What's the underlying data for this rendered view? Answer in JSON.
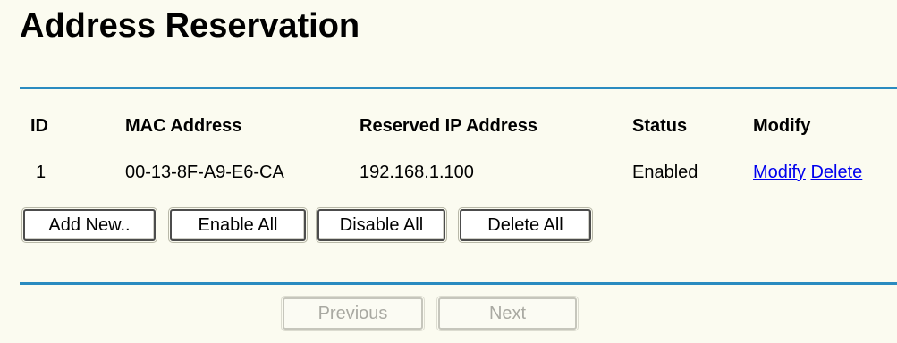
{
  "page": {
    "title": "Address Reservation"
  },
  "table": {
    "headers": {
      "id": "ID",
      "mac": "MAC Address",
      "ip": "Reserved IP Address",
      "status": "Status",
      "modify": "Modify"
    },
    "rows": [
      {
        "id": "1",
        "mac": "00-13-8F-A9-E6-CA",
        "ip": "192.168.1.100",
        "status": "Enabled",
        "modify_link": "Modify",
        "delete_link": "Delete"
      }
    ]
  },
  "actions": {
    "add_new": "Add New..",
    "enable_all": "Enable All",
    "disable_all": "Disable All",
    "delete_all": "Delete All"
  },
  "pagination": {
    "previous": "Previous",
    "next": "Next",
    "previous_enabled": false,
    "next_enabled": false
  },
  "colors": {
    "background": "#fbfbf0",
    "rule": "#2a8bc0",
    "link": "#0000ee"
  }
}
